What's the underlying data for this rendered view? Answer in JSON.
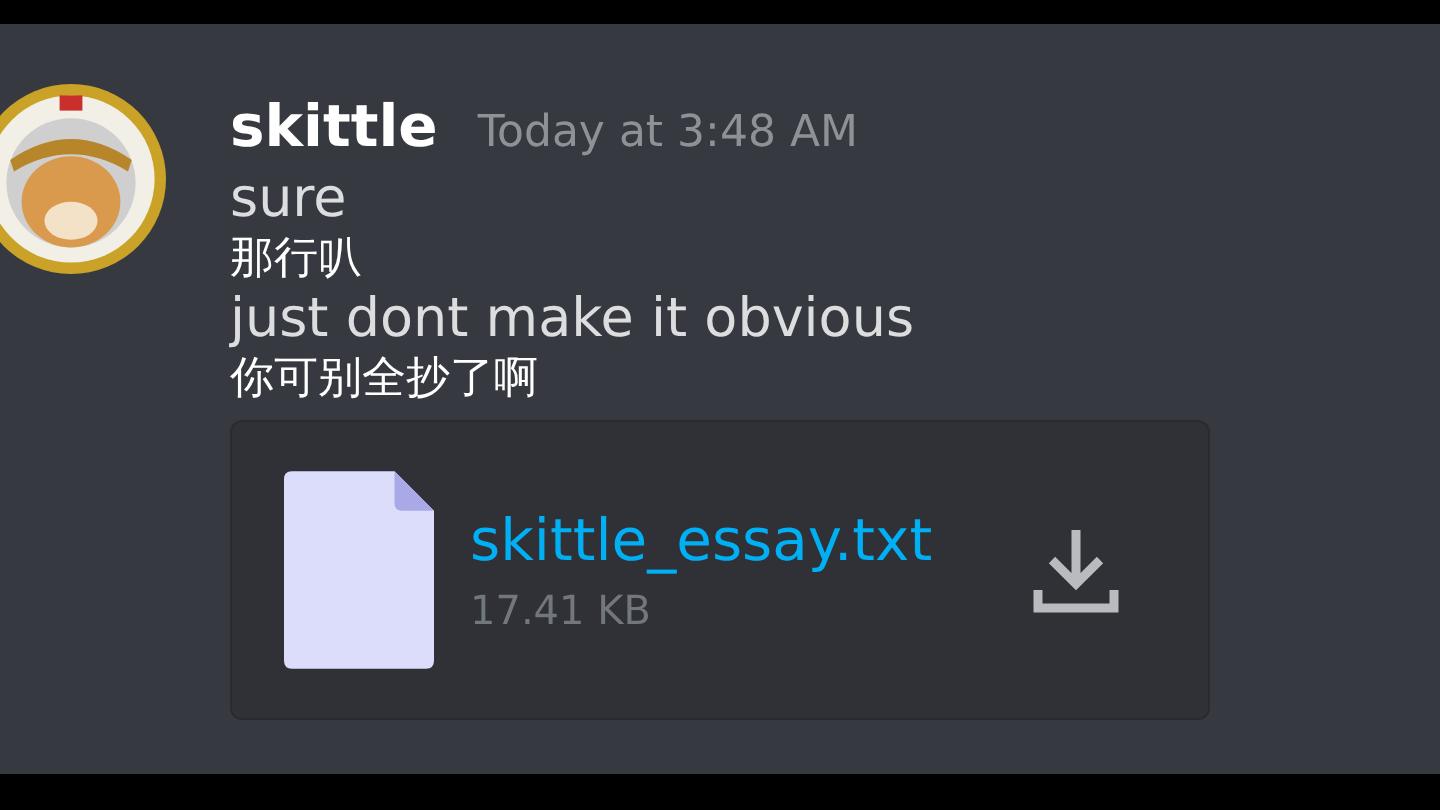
{
  "message": {
    "author": "skittle",
    "timestamp": "Today at 3:48 AM",
    "lines": [
      {
        "kind": "text",
        "text": "sure"
      },
      {
        "kind": "subtitle",
        "text": "那行叭"
      },
      {
        "kind": "text",
        "text": "just dont make it obvious"
      },
      {
        "kind": "subtitle",
        "text": "你可别全抄了啊"
      }
    ],
    "attachment": {
      "filename": "skittle_essay.txt",
      "size": "17.41 KB"
    }
  }
}
